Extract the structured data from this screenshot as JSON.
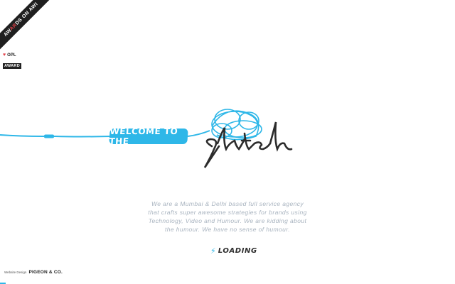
{
  "ribbon": {
    "prefix": "AW",
    "highlight": "AR",
    "suffix": "DS",
    "by": "ON",
    "tail": "AWI"
  },
  "opl_badge": {
    "heart": "♥",
    "label": "OPL",
    "award": "AWARD"
  },
  "hero": {
    "welcome": "WELCOME TO THE",
    "logo_word": "glitch"
  },
  "description": {
    "lines": [
      "We are a Mumbai & Delhi based full service agency",
      "that crafts super awesome strategies for brands using",
      "Technology, Video and Humour. We are kidding about",
      "the humour. We have no sense of humour."
    ]
  },
  "loading": {
    "icon": "⚡",
    "label": "LOADING"
  },
  "footer": {
    "prefix": "Website Design",
    "brand": "PIGEON & CO."
  },
  "colors": {
    "accent": "#2eb7e8",
    "ink": "#2c2c2c",
    "muted": "#a8b3bf",
    "badge_red": "#e2434b"
  }
}
